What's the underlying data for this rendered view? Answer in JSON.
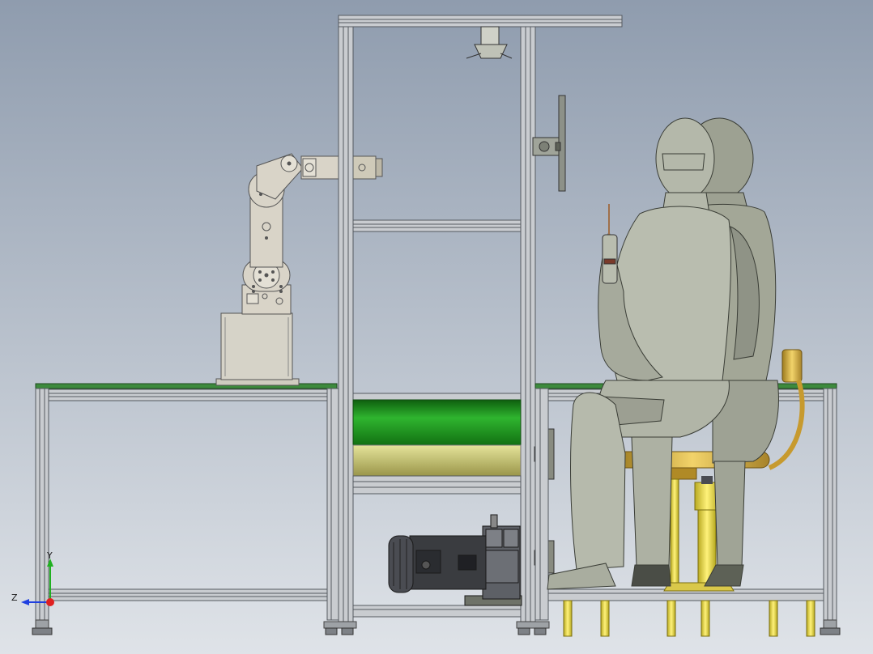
{
  "viewport": {
    "background_top": "#8f9cae",
    "background_bottom": "#dfe3e8"
  },
  "triad": {
    "z_label": "Z",
    "y_label": "Y",
    "x_color": "#e02020",
    "y_color": "#20b020",
    "z_color": "#2040e0"
  },
  "colors": {
    "frame": "#c9ccd0",
    "frame_edge": "#555a60",
    "tabletop": "#3d8a3d",
    "robot": "#d9d4c8",
    "base_box": "#d6d3c8",
    "mannequin": "#a9ad9f",
    "chair_gold": "#d7b34a",
    "chair_yellow": "#e8d94a",
    "roller_green": "#1a8a1a",
    "roller_yellow": "#c9c46a",
    "motor_dark": "#3a3c40"
  }
}
